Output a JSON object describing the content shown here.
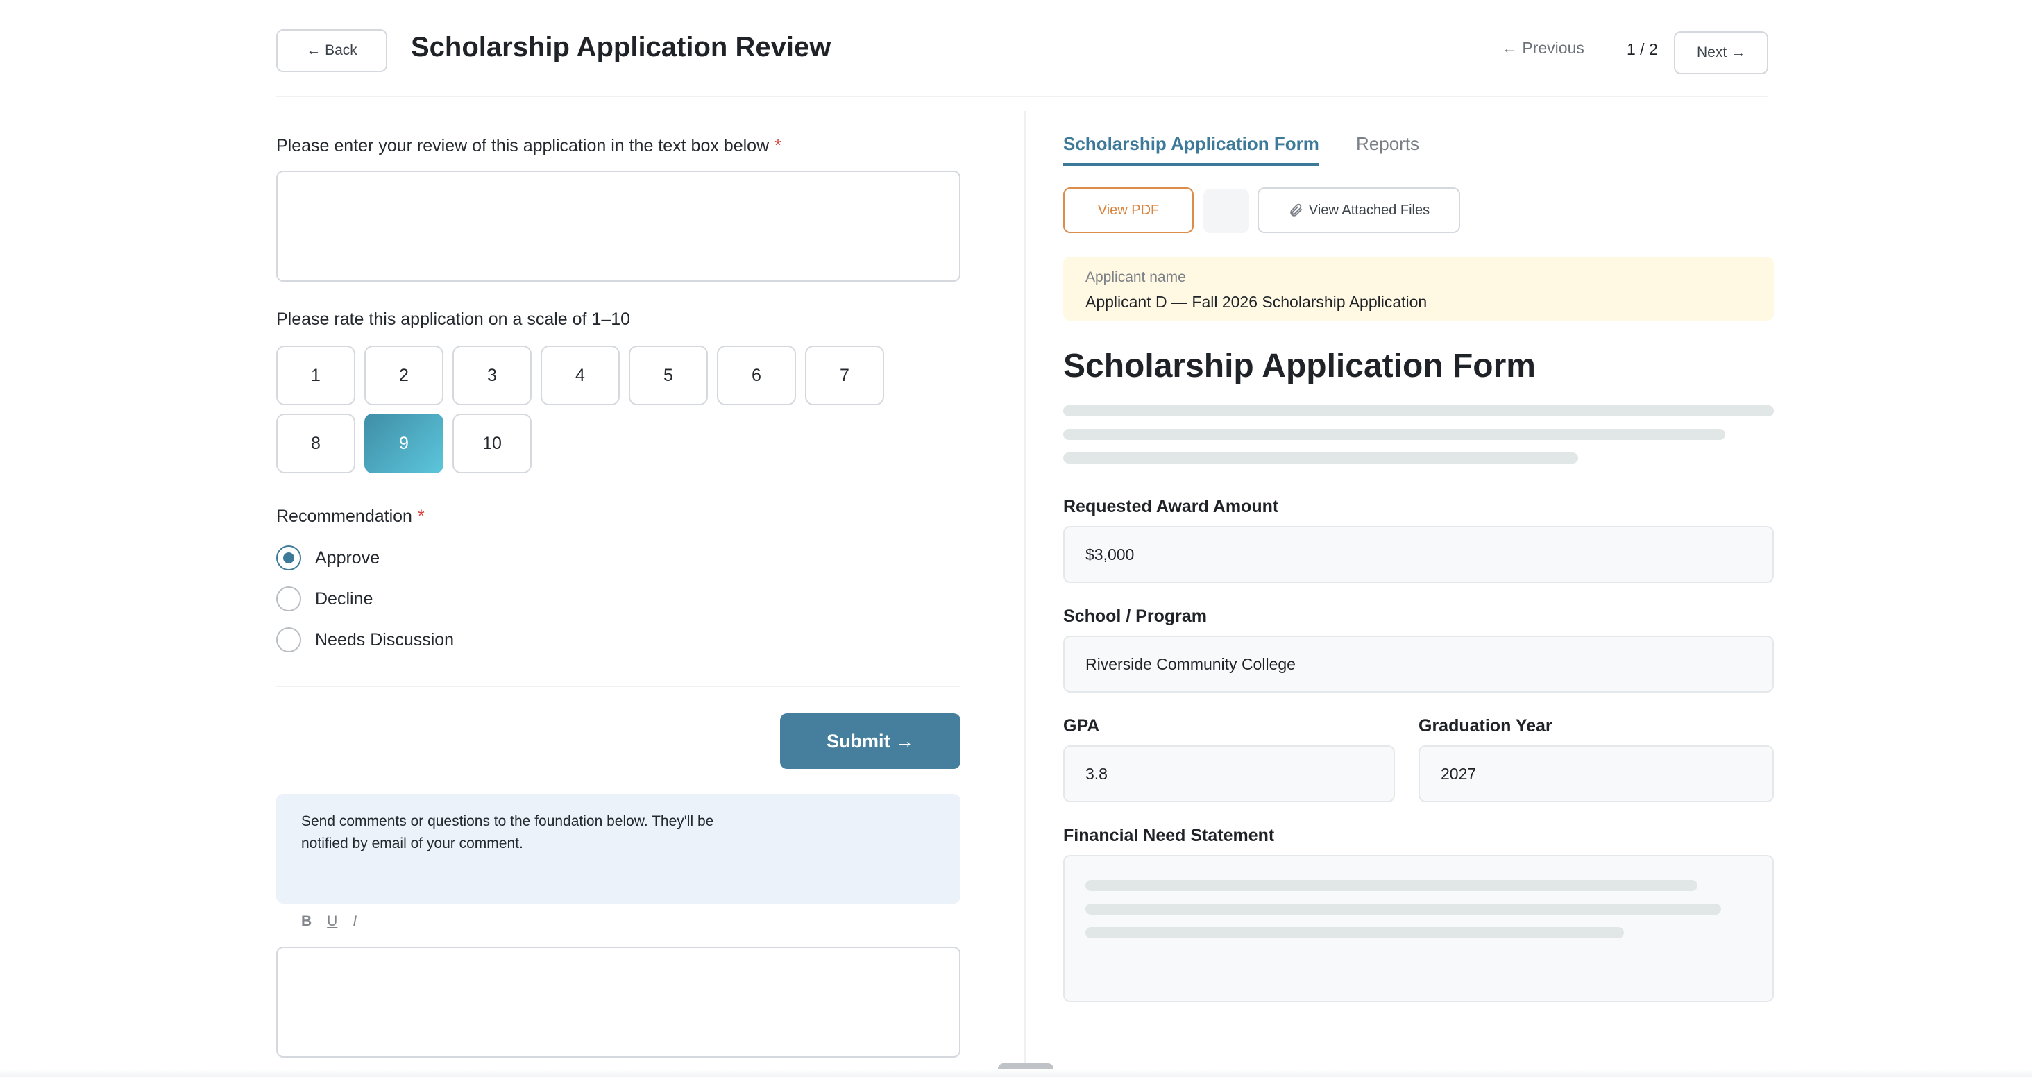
{
  "header": {
    "back_label": "← Back",
    "title": "Scholarship Application Review",
    "previous_label": "← Previous",
    "page_indicator": "1 / 2",
    "next_label": "Next →"
  },
  "review": {
    "prompt": "Please enter your review of this application in the text box below",
    "required_mark": "*",
    "value": ""
  },
  "rating": {
    "prompt": "Please rate this application on a scale of 1–10",
    "options": [
      "1",
      "2",
      "3",
      "4",
      "5",
      "6",
      "7",
      "8",
      "9",
      "10"
    ],
    "selected": 9
  },
  "recommendation": {
    "label": "Recommendation",
    "required_mark": "*",
    "options": [
      "Approve",
      "Decline",
      "Needs Discussion"
    ],
    "selected": "Approve"
  },
  "submit_label": "Submit →",
  "comments": {
    "notice": "Send comments or questions to the foundation below. They'll be notified by email of your comment.",
    "toolbar": {
      "bold": "B",
      "underline": "U",
      "italic": "I"
    },
    "value": ""
  },
  "tabs": [
    {
      "label": "Scholarship Application Form",
      "active": true
    },
    {
      "label": "Reports",
      "active": false
    }
  ],
  "actions": {
    "view_pdf": "View PDF",
    "view_files": "View Attached Files",
    "files_icon": "paperclip-icon"
  },
  "applicant": {
    "label": "Applicant name",
    "value": "Applicant D — Fall 2026 Scholarship Application"
  },
  "form": {
    "title": "Scholarship Application Form",
    "fields": {
      "award_amount": {
        "label": "Requested Award Amount",
        "value": "$3,000"
      },
      "school": {
        "label": "School / Program",
        "value": "Riverside Community College"
      },
      "gpa": {
        "label": "GPA",
        "value": "3.8"
      },
      "graduation_year": {
        "label": "Graduation Year",
        "value": "2027"
      },
      "need_statement": {
        "label": "Financial Need Statement"
      }
    }
  },
  "colors": {
    "accent": "#3d7a99",
    "submit": "#467f9e",
    "pdf_button": "#d9823c",
    "required": "#d7413b",
    "applicant_bg": "#fff8e2",
    "notice_bg": "#ecf2fa"
  }
}
